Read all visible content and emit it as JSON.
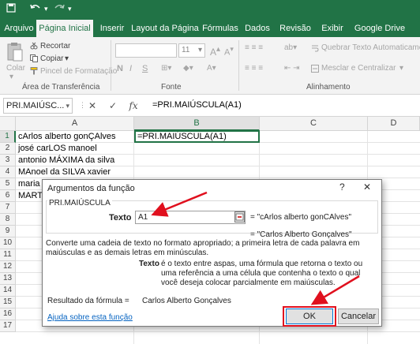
{
  "qat": {
    "save_icon": "save-icon",
    "undo_icon": "undo-icon",
    "redo_icon": "redo-icon"
  },
  "tabs": [
    {
      "label": "Arquivo",
      "active": false
    },
    {
      "label": "Página Inicial",
      "active": true
    },
    {
      "label": "Inserir",
      "active": false
    },
    {
      "label": "Layout da Página",
      "active": false
    },
    {
      "label": "Fórmulas",
      "active": false
    },
    {
      "label": "Dados",
      "active": false
    },
    {
      "label": "Revisão",
      "active": false
    },
    {
      "label": "Exibir",
      "active": false
    },
    {
      "label": "Google Drive",
      "active": false
    }
  ],
  "ribbon": {
    "colar": "Colar",
    "recortar": "Recortar",
    "copiar": "Copiar",
    "pincel": "Pincel de Formatação",
    "clipboard_group": "Área de Transferência",
    "font_size": "11",
    "bold": "N",
    "italic": "I",
    "underline": "S",
    "font_group": "Fonte",
    "wrap_text": "Quebrar Texto Automaticament",
    "merge_center": "Mesclar e Centralizar",
    "align_group": "Alinhamento"
  },
  "formula_bar": {
    "name_box": "PRI.MAIÚSC...",
    "cancel": "✕",
    "enter": "✓",
    "fx": "fx",
    "formula": "=PRI.MAIÚSCULA(A1)"
  },
  "columns": [
    "A",
    "B",
    "C",
    "D"
  ],
  "rows": [
    "1",
    "2",
    "3",
    "4",
    "5",
    "6",
    "7",
    "8",
    "9",
    "10",
    "11",
    "12",
    "13",
    "14",
    "15",
    "16",
    "17"
  ],
  "cells": {
    "A1": "cArlos alberto gonÇAlves",
    "A2": "josé carLOS manoel",
    "A3": "antonio MÁXIMA da silva",
    "A4": "MAnoel da SILVA xavier",
    "A5": "maria",
    "A6": "MART",
    "B1": "=PRI.MAIÚSCULA(A1)"
  },
  "dialog": {
    "title": "Argumentos da função",
    "help": "?",
    "close": "✕",
    "function_name": "PRI.MAIÚSCULA",
    "arg_label": "Texto",
    "arg_value": "A1",
    "arg_result": "=  \"cArlos alberto gonCAlves\"",
    "func_result": "=  \"Carlos Alberto Gonçalves\"",
    "description": "Converte uma cadeia de texto no formato apropriado; a primeira letra de cada palavra em maiúsculas e as demais letras em minúsculas.",
    "arg_desc_name": "Texto",
    "arg_desc": "é o texto entre aspas, uma fórmula que retorna o texto ou uma referência a uma célula que contenha o texto o qual você deseja colocar parcialmente em maiúsculas.",
    "formula_result_label": "Resultado da fórmula =",
    "formula_result_value": "Carlos Alberto Gonçalves",
    "help_link": "Ajuda sobre esta função",
    "ok": "OK",
    "cancel": "Cancelar"
  },
  "colors": {
    "excel_green": "#217346",
    "annotation_red": "#e0101e"
  }
}
